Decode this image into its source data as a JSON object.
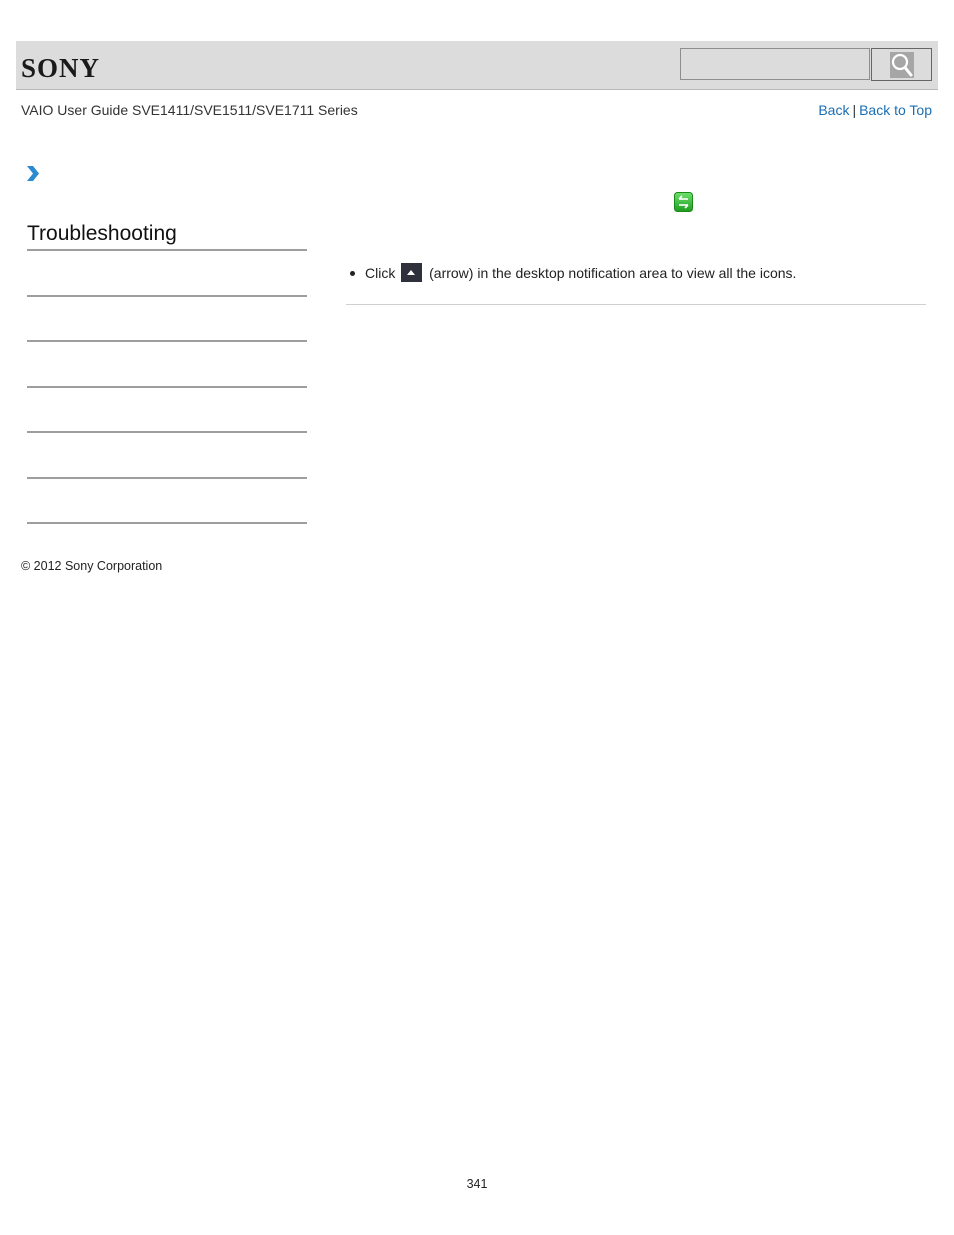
{
  "header": {
    "logo_text": "SONY",
    "search": {
      "value": "",
      "placeholder": "",
      "button_icon": "search-icon"
    }
  },
  "subheader": {
    "guide_title": "VAIO User Guide SVE1411/SVE1511/SVE1711 Series",
    "back_label": "Back",
    "separator": "|",
    "back_to_top_label": "Back to Top"
  },
  "sidebar": {
    "breadcrumb_icon": "chevron-right-icon",
    "section_title": "Troubleshooting",
    "link_count": 6
  },
  "content": {
    "status_icon": "wireless-connection-icon",
    "bullets": [
      {
        "prefix": "Click",
        "icon": "arrow-up-icon",
        "suffix": "(arrow) in the desktop notification area to view all the icons."
      }
    ]
  },
  "footer": {
    "copyright": "© 2012 Sony Corporation",
    "page_number": "341"
  },
  "colors": {
    "link": "#1a6eb3",
    "header_bg": "#dcdcdc",
    "chevron": "#2b8ad0",
    "wireless_icon": "#2fb82f",
    "arrow_box": "#2e313b"
  }
}
